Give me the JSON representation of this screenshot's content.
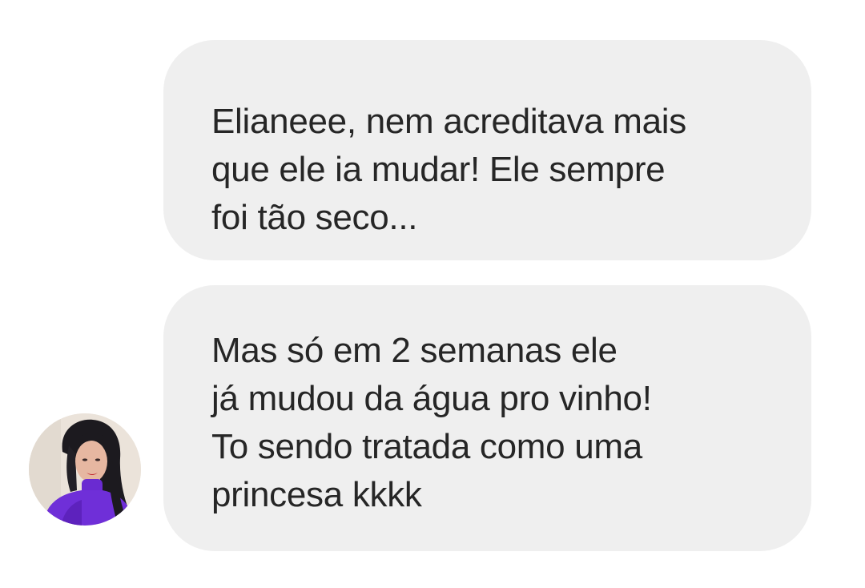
{
  "conversation": {
    "contact_avatar_icon": "user-avatar-photo",
    "messages": [
      {
        "lines": [
          "Elianeee, nem acreditava mais",
          "que ele ia mudar! Ele sempre",
          "foi tão seco..."
        ]
      },
      {
        "lines": [
          "Mas só em 2 semanas ele",
          "já mudou da água pro vinho!",
          "To sendo tratada como uma",
          "princesa kkkk"
        ]
      }
    ]
  },
  "colors": {
    "bubble_background": "#efefef",
    "message_text": "#262626",
    "page_background": "#ffffff"
  }
}
